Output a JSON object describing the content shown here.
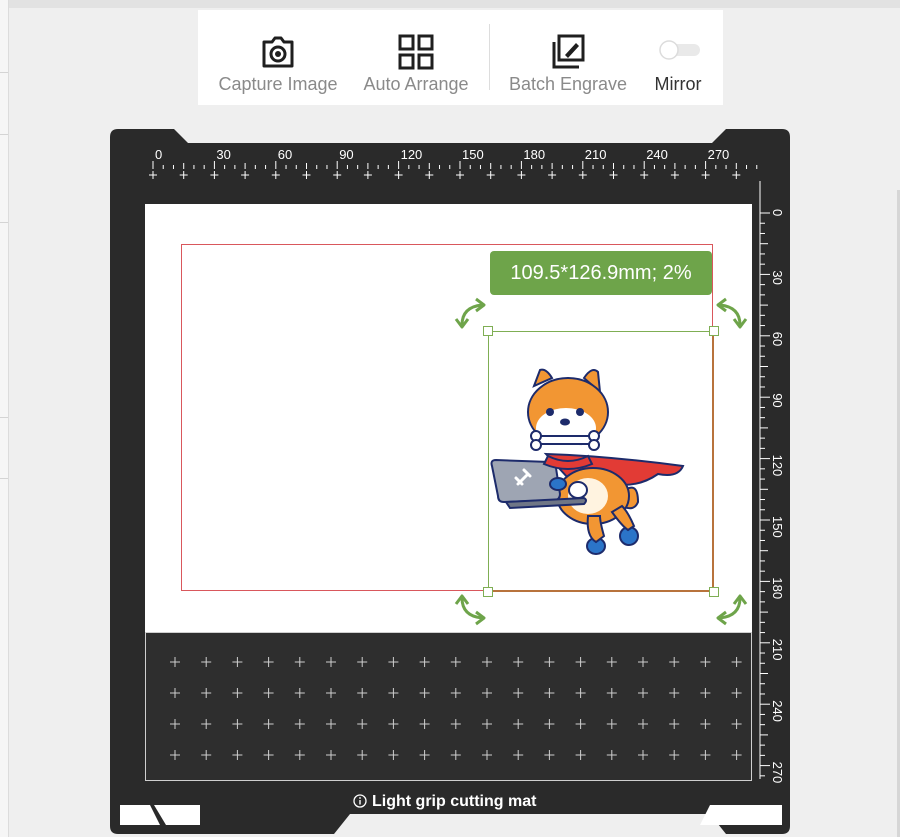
{
  "toolbar": {
    "capture_label": "Capture Image",
    "arrange_label": "Auto Arrange",
    "batch_label": "Batch Engrave",
    "mirror_label": "Mirror",
    "mirror_on": false
  },
  "ruler": {
    "top_ticks": [
      "0",
      "30",
      "60",
      "90",
      "120",
      "150",
      "180",
      "210",
      "240",
      "270"
    ],
    "side_ticks": [
      "0",
      "30",
      "60",
      "90",
      "120",
      "150",
      "180",
      "210",
      "240",
      "270"
    ]
  },
  "canvas": {
    "size_badge": "109.5*126.9mm; 2%",
    "mat_label": "Light grip cutting mat"
  },
  "colors": {
    "accent_green": "#6ea44a",
    "boundary_red": "#d9575c",
    "mat_black": "#2a2a2a"
  }
}
